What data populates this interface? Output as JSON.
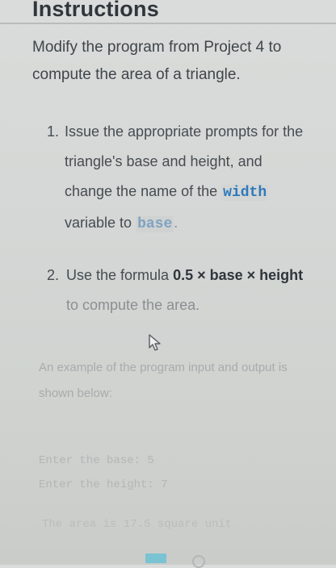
{
  "page": {
    "heading": "Instructions",
    "intro": "Modify the program from Project 4 to compute the area of a triangle."
  },
  "steps": [
    {
      "num": "1.",
      "text_a": "Issue the appropriate prompts for the triangle's base and height, and change the name of the ",
      "code_a": "width",
      "text_b": " variable to ",
      "code_b": "base",
      "text_c": "."
    },
    {
      "num": "2.",
      "text_a": "Use the formula ",
      "strong_a": "0.5 × base × height",
      "text_b": " to compute the area."
    }
  ],
  "example": {
    "caption": "An example of the program input and output is shown below:",
    "line1": "Enter the base: 5",
    "line2": "Enter the height: 7",
    "output": "The area is 17.5 square unit"
  },
  "icons": {
    "cursor": "mouse-pointer-icon"
  },
  "colors": {
    "code": "#2f78bd",
    "background": "#d4d7d5",
    "text": "#3e4449"
  }
}
